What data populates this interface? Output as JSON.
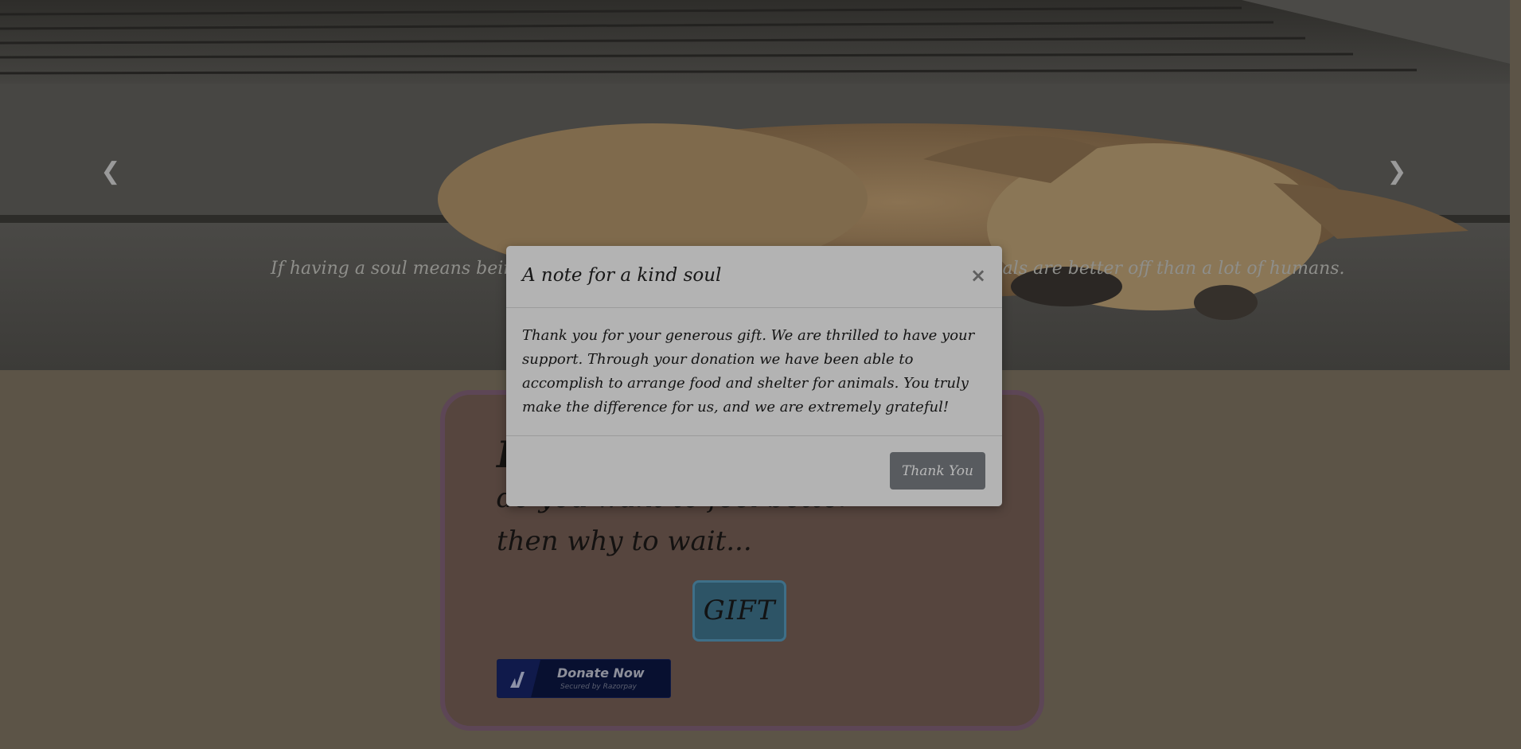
{
  "carousel": {
    "caption": "If having a soul means being able to feel love and loyalty and gratitude, then animals are better off than a lot of humans.",
    "prev_icon": "chevron-left-icon",
    "next_icon": "chevron-right-icon",
    "prev_glyph": "❮",
    "next_glyph": "❯",
    "image": "sleeping-dog-on-stairs"
  },
  "card": {
    "title": "I",
    "line1": "do you want to feel better",
    "line2": "then why to wait...",
    "gift_label": "GIFT",
    "donate": {
      "label": "Donate Now",
      "sublabel": "Secured by Razorpay",
      "icon": "razorpay-logo-icon"
    }
  },
  "modal": {
    "title": "A note for a kind soul",
    "close_glyph": "×",
    "close_icon": "close-icon",
    "body": "Thank you for your generous gift. We are thrilled to have your support. Through your donation we have been able to accomplish to arrange food and shelter for animals. You truly make the difference for us, and we are extremely grateful!",
    "button_label": "Thank You"
  },
  "colors": {
    "overlay_bg": "#5c5447",
    "modal_bg": "#b3b3b3",
    "button_dark": "#585b5f",
    "gift_bg": "#2d5466",
    "card_border": "#5d4656",
    "donate_bg": "#081030"
  }
}
